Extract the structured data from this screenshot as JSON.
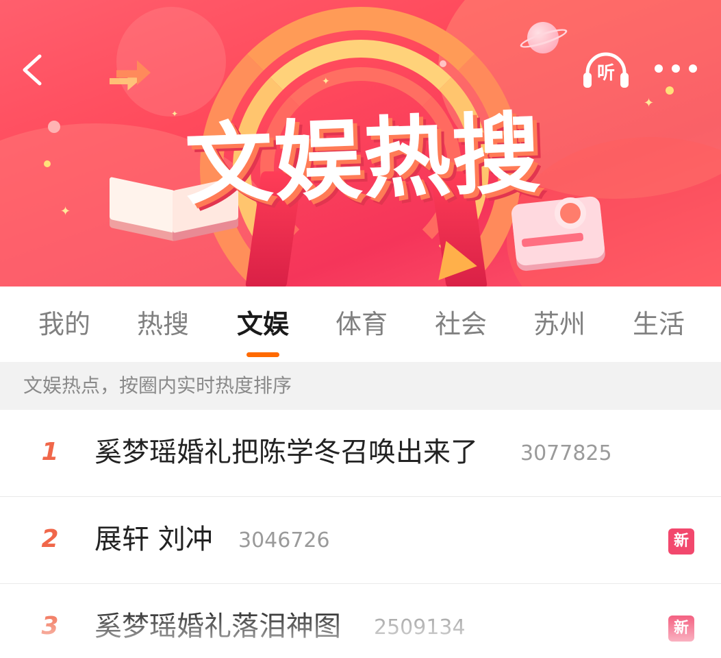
{
  "header": {
    "back_icon": "chevron-left-icon",
    "banner_title": "文娱热搜",
    "listen_label": "听",
    "listen_icon": "headphones-icon",
    "more_icon": "more-dots-icon"
  },
  "tabs": [
    {
      "label": "我的",
      "active": false
    },
    {
      "label": "热搜",
      "active": false
    },
    {
      "label": "文娱",
      "active": true
    },
    {
      "label": "体育",
      "active": false
    },
    {
      "label": "社会",
      "active": false
    },
    {
      "label": "苏州",
      "active": false
    },
    {
      "label": "生活",
      "active": false
    }
  ],
  "info_strip": "文娱热点，按圈内实时热度排序",
  "list": [
    {
      "rank": "1",
      "title": "奚梦瑶婚礼把陈学冬召唤出来了",
      "count": "3077825",
      "badge": ""
    },
    {
      "rank": "2",
      "title": "展轩 刘冲",
      "count": "3046726",
      "badge": "新"
    },
    {
      "rank": "3",
      "title": "奚梦瑶婚礼落泪神图",
      "count": "2509134",
      "badge": "新"
    }
  ],
  "colors": {
    "accent": "#ff6a00",
    "rank": "#f0674a",
    "badge": "#f2486d",
    "banner": "#f5355a"
  }
}
